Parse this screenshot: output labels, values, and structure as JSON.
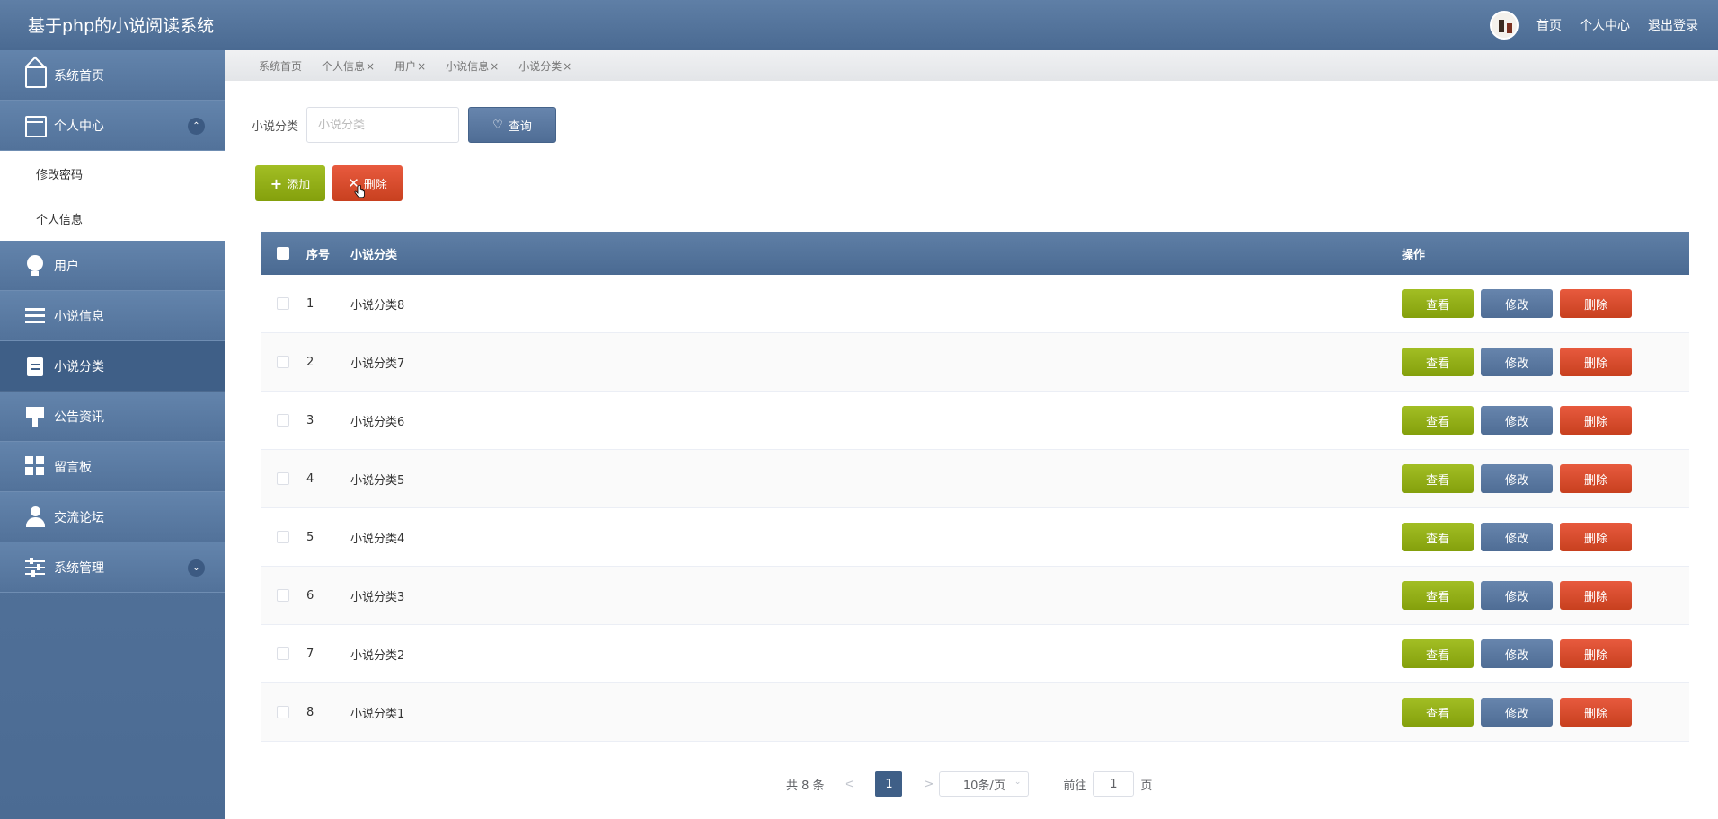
{
  "app": {
    "title": "基于php的小说阅读系统"
  },
  "topnav": {
    "home": "首页",
    "profile_center": "个人中心",
    "logout": "退出登录"
  },
  "sidebar": {
    "items": [
      {
        "label": "系统首页",
        "icon": "home-icon"
      },
      {
        "label": "个人中心",
        "icon": "card-icon",
        "expanded": true,
        "children": [
          {
            "label": "修改密码"
          },
          {
            "label": "个人信息"
          }
        ]
      },
      {
        "label": "用户",
        "icon": "bulb-icon"
      },
      {
        "label": "小说信息",
        "icon": "list-icon"
      },
      {
        "label": "小说分类",
        "icon": "clipboard-icon",
        "active": true
      },
      {
        "label": "公告资讯",
        "icon": "signboard-icon"
      },
      {
        "label": "留言板",
        "icon": "grid-icon"
      },
      {
        "label": "交流论坛",
        "icon": "user-icon"
      },
      {
        "label": "系统管理",
        "icon": "sliders-icon",
        "expanded": false
      }
    ]
  },
  "tabs": [
    "系统首页",
    "个人信息",
    "用户",
    "小说信息",
    "小说分类"
  ],
  "tab_close": "×",
  "search": {
    "label": "小说分类",
    "placeholder": "小说分类",
    "button": "查询"
  },
  "actions": {
    "add": "添加",
    "delete": "删除"
  },
  "table": {
    "headers": {
      "index": "序号",
      "name": "小说分类",
      "ops": "操作"
    },
    "rows": [
      {
        "index": "1",
        "name": "小说分类8"
      },
      {
        "index": "2",
        "name": "小说分类7"
      },
      {
        "index": "3",
        "name": "小说分类6"
      },
      {
        "index": "4",
        "name": "小说分类5"
      },
      {
        "index": "5",
        "name": "小说分类4"
      },
      {
        "index": "6",
        "name": "小说分类3"
      },
      {
        "index": "7",
        "name": "小说分类2"
      },
      {
        "index": "8",
        "name": "小说分类1"
      }
    ],
    "row_ops": {
      "view": "查看",
      "edit": "修改",
      "delete": "删除"
    }
  },
  "pagination": {
    "total": "共 8 条",
    "prev": "<",
    "current": "1",
    "next": ">",
    "page_size": "10条/页",
    "goto_prefix": "前往",
    "goto_value": "1",
    "goto_suffix": "页"
  },
  "colors": {
    "primary": "#4f6d95",
    "success": "#94b01a",
    "danger": "#d84a2c"
  }
}
